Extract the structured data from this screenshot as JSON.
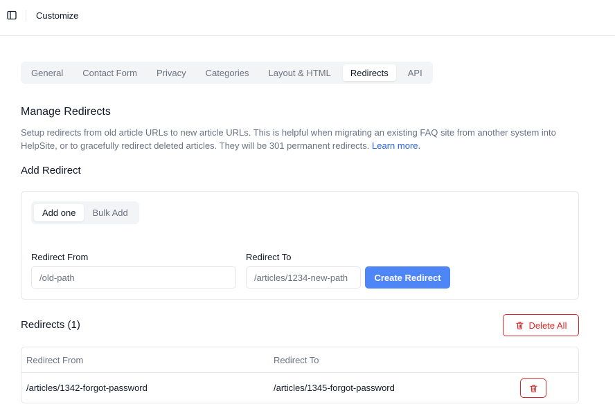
{
  "topbar": {
    "title": "Customize",
    "toggle_icon": "sidebar-toggle-icon"
  },
  "tabs": [
    {
      "label": "General",
      "active": false
    },
    {
      "label": "Contact Form",
      "active": false
    },
    {
      "label": "Privacy",
      "active": false
    },
    {
      "label": "Categories",
      "active": false
    },
    {
      "label": "Layout & HTML",
      "active": false
    },
    {
      "label": "Redirects",
      "active": true
    },
    {
      "label": "API",
      "active": false
    }
  ],
  "manage": {
    "title": "Manage Redirects",
    "description": "Setup redirects from old article URLs to new article URLs. This is helpful when migrating an existing FAQ site from another system into HelpSite, or to gracefully redirect deleted articles. They will be 301 permanent redirects.",
    "learn_more": "Learn more."
  },
  "add_redirect": {
    "title": "Add Redirect",
    "modes": [
      {
        "label": "Add one",
        "active": true
      },
      {
        "label": "Bulk Add",
        "active": false
      }
    ],
    "from_label": "Redirect From",
    "from_placeholder": "/old-path",
    "to_label": "Redirect To",
    "to_placeholder": "/articles/1234-new-path",
    "create_label": "Create Redirect"
  },
  "redirects": {
    "title": "Redirects (1)",
    "delete_all_label": "Delete All",
    "columns": [
      "Redirect From",
      "Redirect To"
    ],
    "rows": [
      {
        "from": "/articles/1342-forgot-password",
        "to": "/articles/1345-forgot-password"
      }
    ]
  },
  "colors": {
    "accent": "#4f86f7",
    "danger": "#dc2626",
    "link": "#2563eb"
  }
}
